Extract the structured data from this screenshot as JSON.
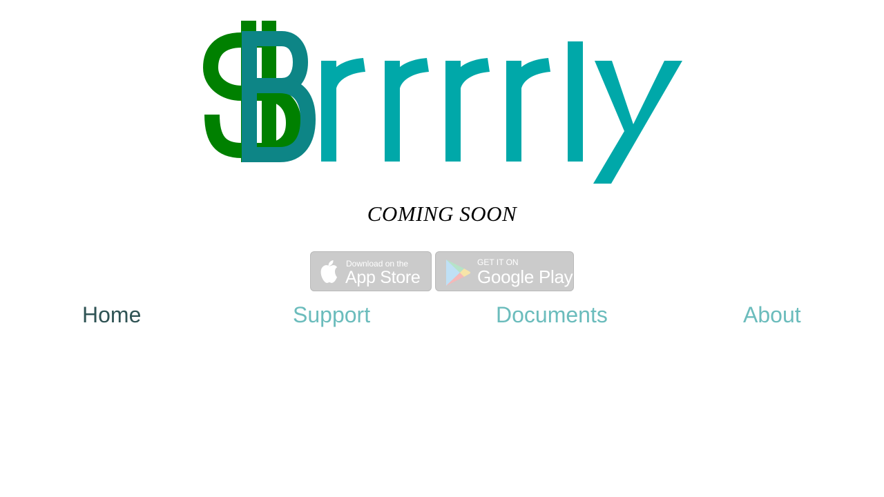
{
  "brand": {
    "logo_text": "$rrrrly",
    "colors": {
      "dollar_green": "#008000",
      "b_teal": "#0d8586",
      "r_teal": "#00a8a9"
    }
  },
  "tagline": "COMING SOON",
  "store_badges": [
    {
      "name": "app-store",
      "icon": "apple-icon",
      "line1": "Download on the",
      "line2": "App Store"
    },
    {
      "name": "google-play",
      "icon": "google-play-icon",
      "line1": "GET IT ON",
      "line2": "Google Play"
    }
  ],
  "nav": {
    "items": [
      {
        "label": "Home",
        "active": true
      },
      {
        "label": "Support",
        "active": false
      },
      {
        "label": "Documents",
        "active": false
      },
      {
        "label": "About",
        "active": false
      }
    ],
    "colors": {
      "active": "#2f5354",
      "inactive": "#6bbcbc"
    }
  }
}
